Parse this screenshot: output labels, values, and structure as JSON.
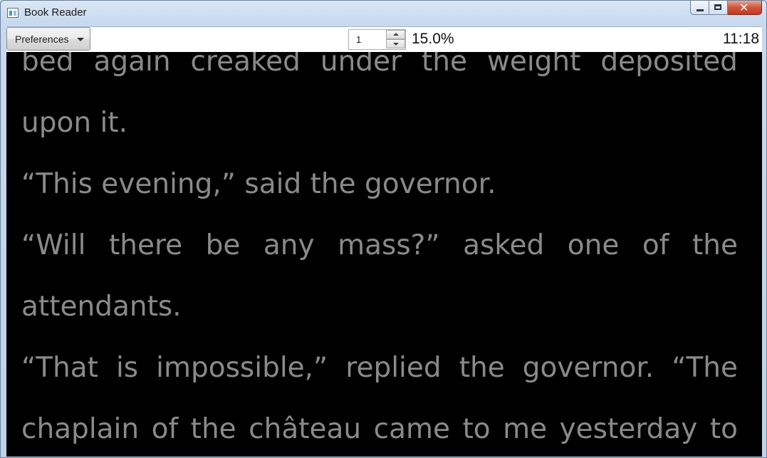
{
  "window": {
    "title": "Book Reader"
  },
  "toolbar": {
    "preferences_label": "Preferences",
    "page_value": "1",
    "progress_text": "15.0%",
    "clock": "11:18"
  },
  "reader": {
    "lines": [
      {
        "words": [
          "bed",
          "again",
          "creaked",
          "under",
          "the",
          "weight",
          "deposited"
        ]
      },
      {
        "text": "upon it."
      },
      {
        "text": " “This evening,” said the governor."
      },
      {
        "words": [
          " “Will",
          "there",
          "be",
          "any",
          "mass?”",
          "asked",
          "one",
          "of",
          "the"
        ]
      },
      {
        "text": "attendants."
      },
      {
        "words": [
          " “That",
          "is",
          "impossible,”",
          "replied",
          "the",
          "governor.",
          "“The"
        ]
      },
      {
        "words": [
          "chaplain",
          "of",
          "the",
          "château",
          "came",
          "to",
          "me",
          "yesterday",
          "to"
        ]
      }
    ]
  }
}
